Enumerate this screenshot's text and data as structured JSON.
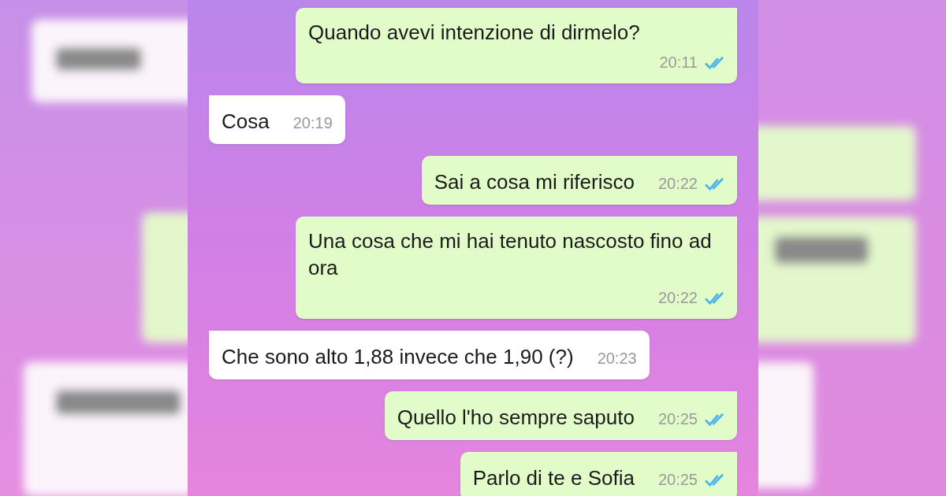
{
  "messages": [
    {
      "kind": "outgoing",
      "text": "Quando avevi intenzione di dirmelo?",
      "time": "20:11",
      "read": true
    },
    {
      "kind": "incoming",
      "text": "Cosa",
      "time": "20:19"
    },
    {
      "kind": "outgoing",
      "text": "Sai a cosa mi riferisco",
      "time": "20:22",
      "read": true
    },
    {
      "kind": "outgoing",
      "text": "Una cosa che mi hai tenuto nascosto fino ad ora",
      "time": "20:22",
      "read": true
    },
    {
      "kind": "incoming",
      "text": "Che sono alto 1,88 invece che 1,90 (?)",
      "time": "20:23"
    },
    {
      "kind": "outgoing",
      "text": "Quello l'ho sempre saputo",
      "time": "20:25",
      "read": true
    },
    {
      "kind": "outgoing",
      "text": "Parlo di te e Sofia",
      "time": "20:25",
      "read": true
    }
  ]
}
